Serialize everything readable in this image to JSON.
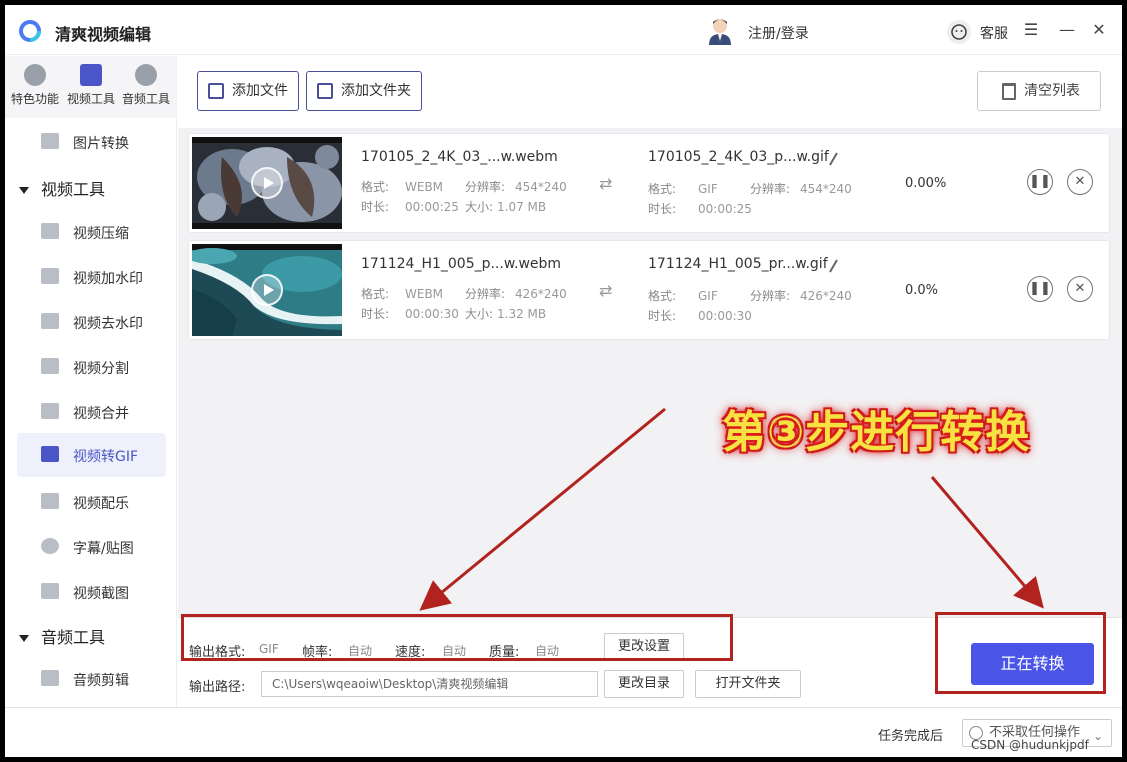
{
  "app": {
    "title": "清爽视频编辑",
    "login": "注册/登录",
    "customer_service": "客服",
    "menu_icon": "hamburger-icon",
    "min_icon": "minimize-icon",
    "close_icon": "close-icon"
  },
  "sidebar": {
    "tabs": [
      {
        "label": "特色功能",
        "icon": "star-icon"
      },
      {
        "label": "视频工具",
        "icon": "film-icon"
      },
      {
        "label": "音频工具",
        "icon": "audio-icon"
      }
    ],
    "items": [
      {
        "label": "图片转换"
      },
      {
        "label": "视频工具",
        "group": true
      },
      {
        "label": "视频压缩"
      },
      {
        "label": "视频加水印"
      },
      {
        "label": "视频去水印"
      },
      {
        "label": "视频分割"
      },
      {
        "label": "视频合并"
      },
      {
        "label": "视频转GIF",
        "active": true
      },
      {
        "label": "视频配乐"
      },
      {
        "label": "字幕/贴图"
      },
      {
        "label": "视频截图"
      },
      {
        "label": "音频工具",
        "group": true
      },
      {
        "label": "音频剪辑"
      }
    ]
  },
  "toolbar": {
    "add_file": "添加文件",
    "add_folder": "添加文件夹",
    "clear_list": "清空列表"
  },
  "files": [
    {
      "src_name": "170105_2_4K_03_...w.webm",
      "src_format_label": "格式:",
      "src_format": "WEBM",
      "src_res_label": "分辨率:",
      "src_res": "454*240",
      "src_dur_label": "时长:",
      "src_dur": "00:00:25",
      "src_size_label": "大小:",
      "src_size": "1.07 MB",
      "dst_name": "170105_2_4K_03_p...w.gif",
      "dst_format_label": "格式:",
      "dst_format": "GIF",
      "dst_res_label": "分辨率:",
      "dst_res": "454*240",
      "dst_dur_label": "时长:",
      "dst_dur": "00:00:25",
      "progress": "0.00%"
    },
    {
      "src_name": "171124_H1_005_p...w.webm",
      "src_format_label": "格式:",
      "src_format": "WEBM",
      "src_res_label": "分辨率:",
      "src_res": "426*240",
      "src_dur_label": "时长:",
      "src_dur": "00:00:30",
      "src_size_label": "大小:",
      "src_size": "1.32 MB",
      "dst_name": "171124_H1_005_pr...w.gif",
      "dst_format_label": "格式:",
      "dst_format": "GIF",
      "dst_res_label": "分辨率:",
      "dst_res": "426*240",
      "dst_dur_label": "时长:",
      "dst_dur": "00:00:30",
      "progress": "0.0%"
    }
  ],
  "output": {
    "format_label": "输出格式:",
    "format": "GIF",
    "fps_label": "帧率:",
    "fps": "自动",
    "speed_label": "速度:",
    "speed": "自动",
    "quality_label": "质量:",
    "quality": "自动",
    "change_settings": "更改设置",
    "path_label": "输出路径:",
    "path": "C:\\Users\\wqeaoiw\\Desktop\\清爽视频编辑",
    "change_dir": "更改目录",
    "open_folder": "打开文件夹",
    "convert": "正在转换"
  },
  "status": {
    "after_label": "任务完成后",
    "after_value": "不采取任何操作",
    "watermark": "CSDN @hudunkjpdf"
  },
  "annotation": {
    "text": "第③步进行转换",
    "color": "#b2231f",
    "text_color": "#f6e341"
  }
}
